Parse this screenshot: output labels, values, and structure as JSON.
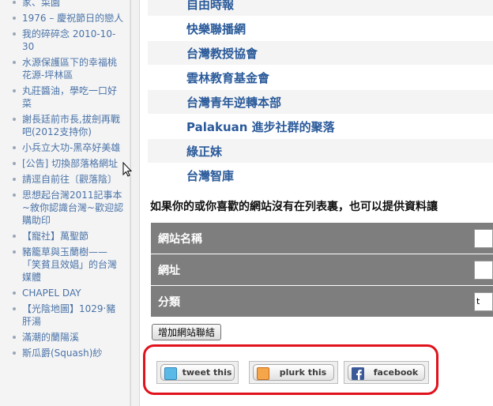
{
  "sidebar": {
    "items": [
      {
        "label": "家、菜園"
      },
      {
        "label": "1976 – 慶祝節日的戀人"
      },
      {
        "label": "我的碎碎念 2010-10-30"
      },
      {
        "label": "水源保護區下的幸福桃花源-坪林區"
      },
      {
        "label": "丸莊醬油，學吃一口好菜"
      },
      {
        "label": "謝長廷前市長,拔劍再戰吧(2012支持你)"
      },
      {
        "label": "小兵立大功-黑卒好美雄"
      },
      {
        "label": "[公告] 切換部落格網址"
      },
      {
        "label": "請逕自前往〔觀落陰〕"
      },
      {
        "label": "思想起台灣2011記事本~敘你認識台灣~歡迎認購助印"
      },
      {
        "label": "【寵社】萬聖節"
      },
      {
        "label": "豬籠草與玉蘭樹——「笑貧且效娼」的台灣媒體"
      },
      {
        "label": "CHAPEL DAY"
      },
      {
        "label": "【光陰地圖】1029‧豬肝湯"
      },
      {
        "label": "滿潮的蘭陽溪"
      },
      {
        "label": "斯瓜爵(Squash)紗"
      }
    ]
  },
  "links": [
    {
      "label": "自由時報"
    },
    {
      "label": "快樂聯播網"
    },
    {
      "label": "台灣教授協會"
    },
    {
      "label": "雲林教育基金會"
    },
    {
      "label": "台灣青年逆轉本部"
    },
    {
      "label": "Palakuan 進步社群的聚落"
    },
    {
      "label": "綠正妹"
    },
    {
      "label": "台灣智庫"
    }
  ],
  "form": {
    "intro": "如果你的或你喜歡的網站沒有在列表裏，也可以提供資料讓",
    "fields": [
      {
        "label": "網站名稱",
        "value": ""
      },
      {
        "label": "網址",
        "value": ""
      },
      {
        "label": "分類",
        "value": "t"
      }
    ],
    "submit_label": "增加網站聯結"
  },
  "share": {
    "twitter_label": "tweet this",
    "plurk_label": "plurk this",
    "facebook_label": "facebook",
    "twitter_icon": "twitter-icon",
    "plurk_icon": "plurk-icon",
    "facebook_icon": "facebook-icon",
    "highlight_color": "#e0121b"
  }
}
